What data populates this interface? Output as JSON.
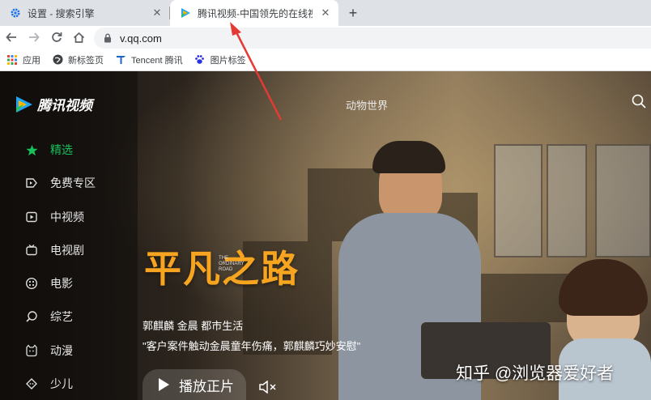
{
  "tabs": [
    {
      "title": "设置 - 搜索引擎",
      "icon": "gear-icon",
      "active": false
    },
    {
      "title": "腾讯视频-中国领先的在线视频媒",
      "icon": "tencent-video-icon",
      "active": true
    }
  ],
  "toolbar": {
    "url": "v.qq.com"
  },
  "bookmarks": [
    {
      "label": "应用",
      "icon": "apps-grid-icon"
    },
    {
      "label": "新标签页",
      "icon": "globe-icon"
    },
    {
      "label": "Tencent 腾讯",
      "icon": "tencent-icon"
    },
    {
      "label": "图片标签",
      "icon": "baidu-paw-icon"
    }
  ],
  "site": {
    "logo_text": "腾讯视频",
    "search_placeholder": "动物世界"
  },
  "nav": [
    {
      "label": "精选",
      "icon": "star-icon",
      "active": true
    },
    {
      "label": "免费专区",
      "icon": "play-tag-icon",
      "active": false
    },
    {
      "label": "中视频",
      "icon": "video-square-icon",
      "active": false
    },
    {
      "label": "电视剧",
      "icon": "tv-icon",
      "active": false
    },
    {
      "label": "电影",
      "icon": "film-reel-icon",
      "active": false
    },
    {
      "label": "综艺",
      "icon": "variety-icon",
      "active": false
    },
    {
      "label": "动漫",
      "icon": "anime-icon",
      "active": false
    },
    {
      "label": "少儿",
      "icon": "kids-icon",
      "active": false
    }
  ],
  "hero": {
    "title": "平凡之路",
    "title_en": "THE ORDINARY ROAD",
    "meta": "郭麒麟 金晨 都市生活",
    "desc": "\"客户案件触动金晨童年伤痛，郭麒麟巧妙安慰\"",
    "play_label": "播放正片"
  },
  "watermark": "知乎 @浏览器爱好者",
  "colors": {
    "accent_green": "#17c25a",
    "title_orange": "#f7a520",
    "annotation_red": "#e53935"
  }
}
